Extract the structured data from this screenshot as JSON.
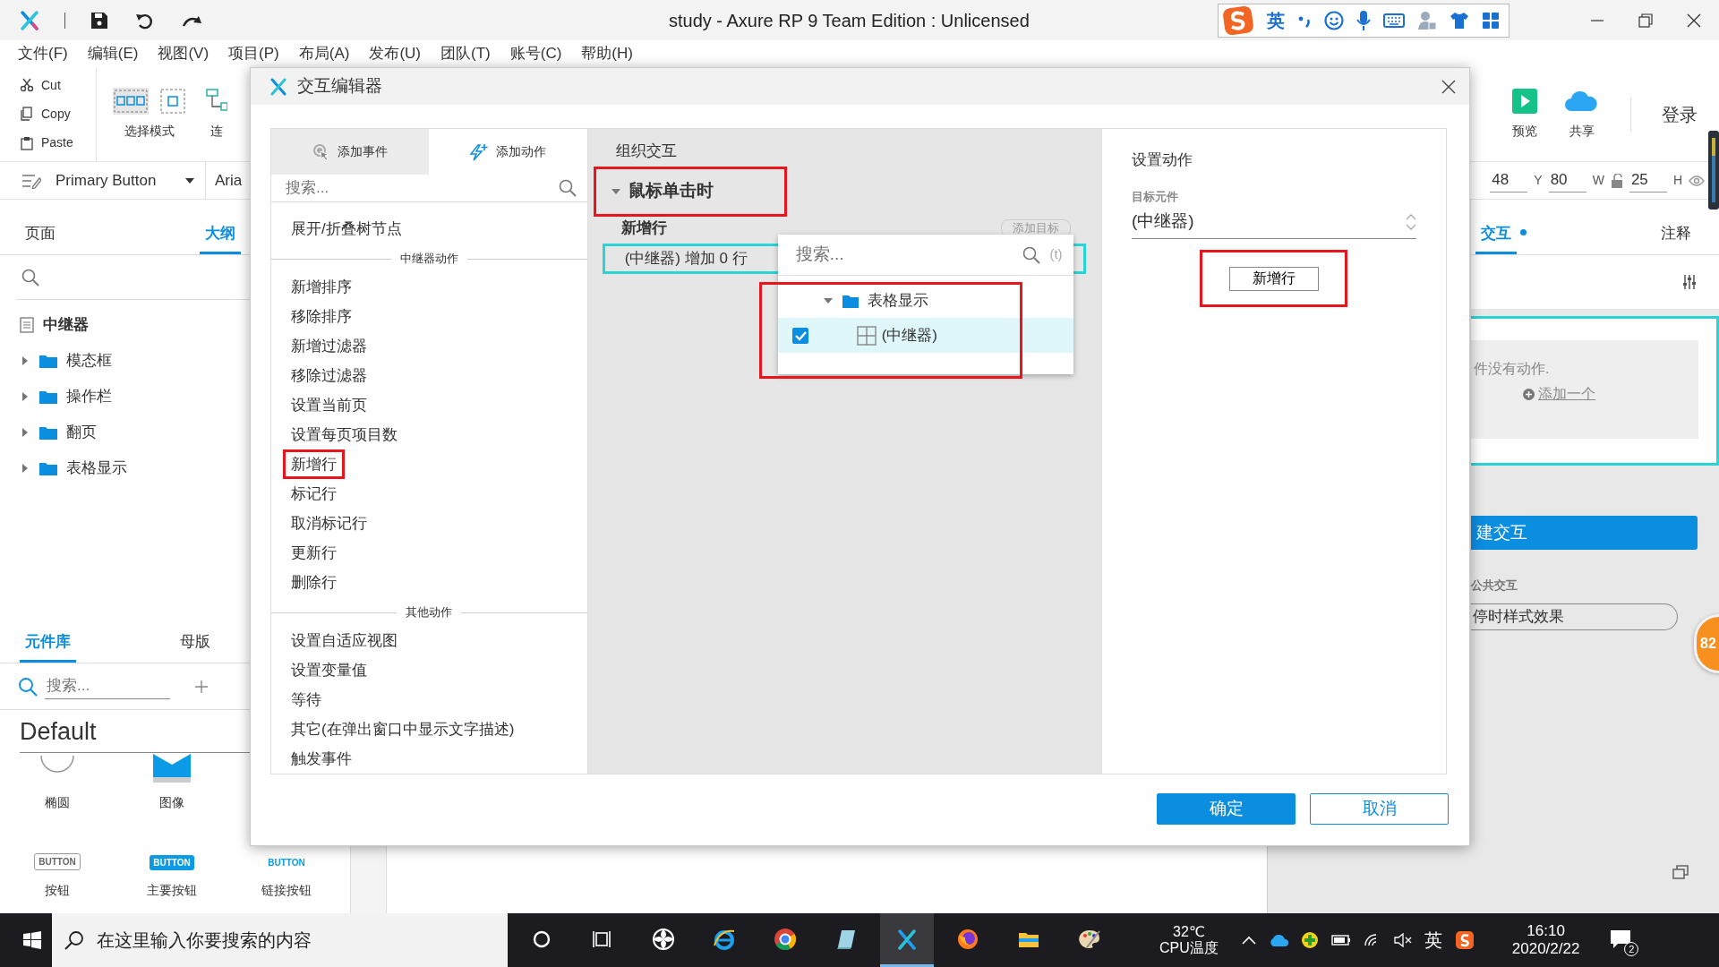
{
  "window": {
    "title": "study - Axure RP 9 Team Edition : Unlicensed"
  },
  "ime_bar": {
    "mode": "英"
  },
  "menu": [
    "文件(F)",
    "编辑(E)",
    "视图(V)",
    "项目(P)",
    "布局(A)",
    "发布(U)",
    "团队(T)",
    "账号(C)",
    "帮助(H)"
  ],
  "toolbar": {
    "clipboard": [
      {
        "label": "Cut",
        "kind": "cut"
      },
      {
        "label": "Copy",
        "kind": "copy"
      },
      {
        "label": "Paste",
        "kind": "paste"
      }
    ],
    "tools": [
      {
        "label": "选择模式",
        "kind": "select"
      },
      {
        "label": "连",
        "kind": "connect"
      }
    ],
    "actions": [
      {
        "label": "预览",
        "kind": "preview"
      },
      {
        "label": "共享",
        "kind": "share"
      }
    ],
    "login": "登录"
  },
  "style_bar": {
    "style": "Primary Button",
    "font": "Aria",
    "geometry": [
      {
        "kind": "value",
        "text": "48"
      },
      {
        "kind": "label",
        "text": "Y"
      },
      {
        "kind": "value",
        "text": "80"
      },
      {
        "kind": "label",
        "text": "W"
      },
      {
        "kind": "lock"
      },
      {
        "kind": "value",
        "text": "25"
      },
      {
        "kind": "label",
        "text": "H"
      }
    ]
  },
  "outline_panel": {
    "tabs": [
      {
        "label": "页面",
        "selected": false
      },
      {
        "label": "大纲",
        "selected": true
      }
    ],
    "page": "中继器",
    "items": [
      {
        "label": "模态框",
        "expanded": false
      },
      {
        "label": "操作栏",
        "expanded": false
      },
      {
        "label": "翻页",
        "expanded": false
      },
      {
        "label": "表格显示",
        "expanded": false
      }
    ]
  },
  "library_panel": {
    "tabs": [
      {
        "label": "元件库",
        "selected": true
      },
      {
        "label": "母版",
        "selected": false
      }
    ],
    "placeholder": "搜索...",
    "library": "Default",
    "widgets": [
      {
        "label": "椭圆",
        "kind": "circle"
      },
      {
        "label": "图像",
        "kind": "image"
      },
      {
        "label": "按钮",
        "kind": "button",
        "caption": "BUTTON"
      },
      {
        "label": "主要按钮",
        "kind": "primary",
        "caption": "BUTTON"
      },
      {
        "label": "链接按钮",
        "kind": "link",
        "caption": "BUTTON"
      }
    ]
  },
  "dialog": {
    "title": "交互编辑器",
    "tabs": [
      {
        "label": "添加事件",
        "kind": "event",
        "selected": false
      },
      {
        "label": "添加动作",
        "kind": "action",
        "selected": true
      }
    ],
    "placeholder": "搜索...",
    "actions": [
      {
        "kind": "item",
        "label": "展开/折叠树节点",
        "highlighted": false
      },
      {
        "kind": "section",
        "label": "中继器动作"
      },
      {
        "kind": "item",
        "label": "新增排序",
        "highlighted": false
      },
      {
        "kind": "item",
        "label": "移除排序",
        "highlighted": false
      },
      {
        "kind": "item",
        "label": "新增过滤器",
        "highlighted": false
      },
      {
        "kind": "item",
        "label": "移除过滤器",
        "highlighted": false
      },
      {
        "kind": "item",
        "label": "设置当前页",
        "highlighted": false
      },
      {
        "kind": "item",
        "label": "设置每页项目数",
        "highlighted": false
      },
      {
        "kind": "item",
        "label": "新增行",
        "highlighted": true
      },
      {
        "kind": "item",
        "label": "标记行",
        "highlighted": false
      },
      {
        "kind": "item",
        "label": "取消标记行",
        "highlighted": false
      },
      {
        "kind": "item",
        "label": "更新行",
        "highlighted": false
      },
      {
        "kind": "item",
        "label": "删除行",
        "highlighted": false
      },
      {
        "kind": "section",
        "label": "其他动作"
      },
      {
        "kind": "item",
        "label": "设置自适应视图",
        "highlighted": false
      },
      {
        "kind": "item",
        "label": "设置变量值",
        "highlighted": false
      },
      {
        "kind": "item",
        "label": "等待",
        "highlighted": false
      },
      {
        "kind": "item",
        "label": "其它(在弹出窗口中显示文字描述)",
        "highlighted": false
      },
      {
        "kind": "item",
        "label": "触发事件",
        "highlighted": false
      }
    ],
    "organize": {
      "title": "组织交互",
      "event": {
        "label": "鼠标单击时",
        "expanded": true,
        "highlighted": true
      },
      "action": {
        "label": "新增行",
        "add_target": "添加目标",
        "target": "(中继器) 增加 0 行",
        "selected": true
      }
    },
    "picker": {
      "placeholder": "搜索...",
      "fx": "(t)",
      "highlighted": true,
      "tree": [
        {
          "label": "表格显示",
          "kind": "folder",
          "expanded": true,
          "children": [
            {
              "label": "(中继器)",
              "kind": "repeater",
              "checked": true,
              "selected": true
            }
          ]
        }
      ]
    },
    "settings": {
      "title": "设置动作",
      "target_label": "目标元件",
      "target_value": "(中继器)",
      "mode_button": {
        "label": "新增行",
        "highlighted": true
      }
    },
    "buttons": [
      {
        "label": "确定",
        "kind": "primary"
      },
      {
        "label": "取消",
        "kind": "secondary"
      }
    ]
  },
  "inspector": {
    "tabs": [
      {
        "label": "交互",
        "selected": true,
        "dot": true
      },
      {
        "label": "注释",
        "selected": false,
        "dot": false
      }
    ],
    "empty_text": "件没有动作.",
    "add_link": "添加一个",
    "new_button": "建交互",
    "shared_label": "公共交互",
    "shared_item": "停时样式效果",
    "badge": "82"
  },
  "taskbar": {
    "search_placeholder": "在这里输入你要搜索的内容",
    "apps": [
      {
        "kind": "cortana",
        "selected": false
      },
      {
        "kind": "taskview",
        "selected": false
      },
      {
        "kind": "pinwheel",
        "selected": false
      },
      {
        "kind": "ie",
        "selected": false
      },
      {
        "kind": "chrome",
        "selected": false
      },
      {
        "kind": "book",
        "selected": false
      },
      {
        "kind": "axure",
        "selected": true
      },
      {
        "kind": "firefox",
        "selected": false
      },
      {
        "kind": "explorer",
        "selected": false
      },
      {
        "kind": "paint",
        "selected": false
      }
    ],
    "temperature": "32℃",
    "temperature_label": "CPU温度",
    "ime": "英",
    "time": "16:10",
    "date": "2020/2/22",
    "notifications": "2"
  }
}
